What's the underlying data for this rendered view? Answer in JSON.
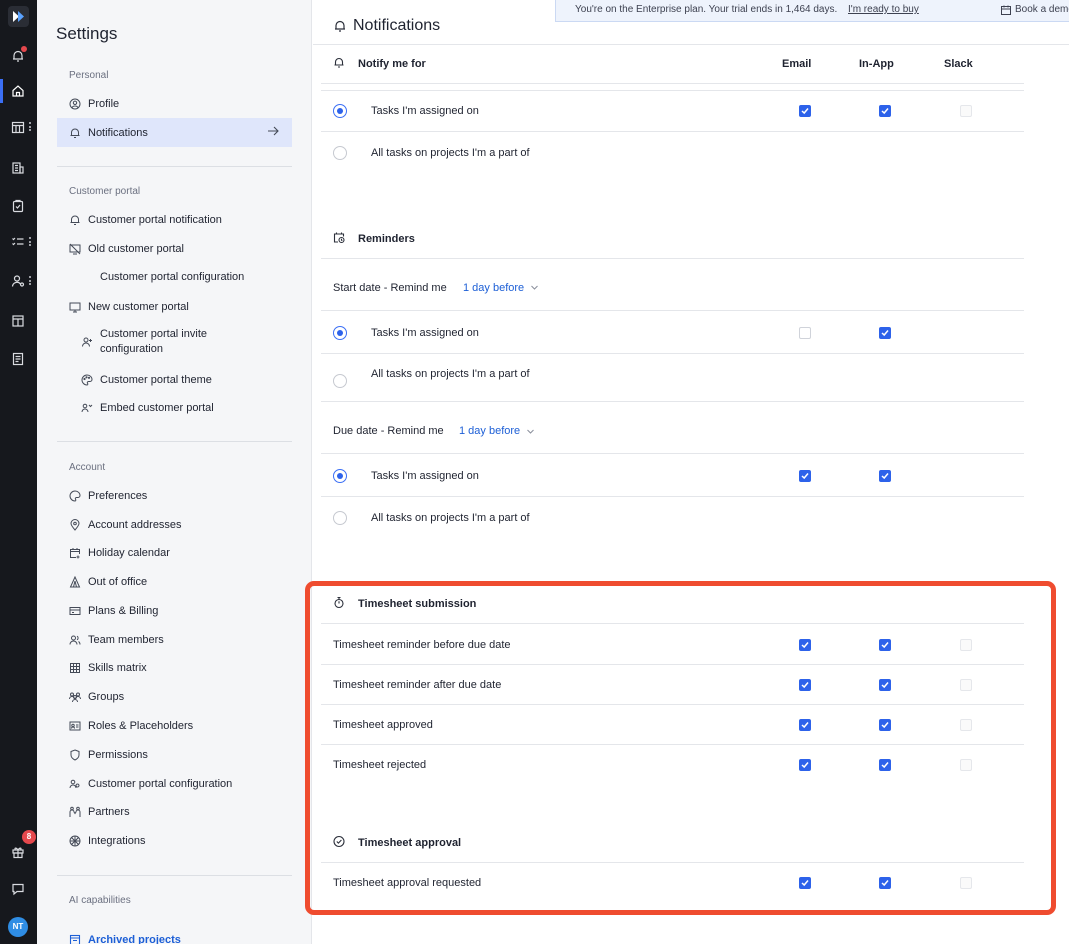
{
  "rail": {
    "avatar": "NT",
    "badge_count": "8"
  },
  "sidebar": {
    "title": "Settings",
    "personal_label": "Personal",
    "personal": [
      {
        "label": "Profile",
        "icon": "user-icon"
      },
      {
        "label": "Notifications",
        "icon": "bell-icon",
        "active": true
      }
    ],
    "customer_portal_label": "Customer portal",
    "customer_portal": [
      {
        "label": "Customer portal notification",
        "icon": "bell-icon"
      },
      {
        "label": "Old customer portal",
        "icon": "monitor-off-icon"
      },
      {
        "label": "Customer portal configuration",
        "icon": "",
        "sub": true
      },
      {
        "label": "New customer portal",
        "icon": "monitor-icon"
      },
      {
        "label": "Customer portal invite configuration",
        "icon": "user-plus-icon",
        "sub": true
      },
      {
        "label": "Customer portal theme",
        "icon": "palette-icon",
        "sub": true
      },
      {
        "label": "Embed customer portal",
        "icon": "users-icon",
        "sub": true
      }
    ],
    "account_label": "Account",
    "account": [
      {
        "label": "Preferences",
        "icon": "palette-icon"
      },
      {
        "label": "Account addresses",
        "icon": "map-pin-icon"
      },
      {
        "label": "Holiday calendar",
        "icon": "calendar-plus-icon"
      },
      {
        "label": "Out of office",
        "icon": "tent-icon"
      },
      {
        "label": "Plans & Billing",
        "icon": "billing-icon"
      },
      {
        "label": "Team members",
        "icon": "users-icon"
      },
      {
        "label": "Skills matrix",
        "icon": "grid-icon"
      },
      {
        "label": "Groups",
        "icon": "group-icon"
      },
      {
        "label": "Roles & Placeholders",
        "icon": "id-card-icon"
      },
      {
        "label": "Permissions",
        "icon": "shield-icon"
      },
      {
        "label": "Customer portal configuration",
        "icon": "users-icon"
      },
      {
        "label": "Partners",
        "icon": "handshake-icon"
      },
      {
        "label": "Integrations",
        "icon": "puzzle-icon"
      }
    ],
    "ai_label": "AI capabilities",
    "archived": "Archived projects"
  },
  "main": {
    "title": "Notifications",
    "banner": {
      "text": "You're on the Enterprise plan. Your trial ends in 1,464 days.",
      "buy": "I'm ready to buy",
      "demo": "Book a demo"
    },
    "columns": [
      "Email",
      "In-App",
      "Slack"
    ],
    "notify_header": "Notify me for",
    "notify_rows": [
      {
        "label": "Tasks I'm assigned on",
        "selected": true,
        "email": true,
        "inapp": true,
        "slack": false
      },
      {
        "label": "All tasks on projects I'm a part of",
        "selected": false
      }
    ],
    "reminders_header": "Reminders",
    "start_label": "Start date - Remind me",
    "start_value": "1 day before",
    "start_rows": [
      {
        "label": "Tasks I'm assigned on",
        "selected": true,
        "email": false,
        "inapp": true
      },
      {
        "label": "All tasks on projects I'm a part of",
        "selected": false
      }
    ],
    "due_label": "Due date - Remind me",
    "due_value": "1 day before",
    "due_rows": [
      {
        "label": "Tasks I'm assigned on",
        "selected": true,
        "email": true,
        "inapp": true
      },
      {
        "label": "All tasks on projects I'm a part of",
        "selected": false
      }
    ],
    "timesheet_header": "Timesheet submission",
    "timesheet_rows": [
      {
        "label": "Timesheet reminder before due date",
        "email": true,
        "inapp": true,
        "slack": false
      },
      {
        "label": "Timesheet reminder after due date",
        "email": true,
        "inapp": true,
        "slack": false
      },
      {
        "label": "Timesheet approved",
        "email": true,
        "inapp": true,
        "slack": false
      },
      {
        "label": "Timesheet rejected",
        "email": true,
        "inapp": true,
        "slack": false
      }
    ],
    "approval_header": "Timesheet approval",
    "approval_rows": [
      {
        "label": "Timesheet approval requested",
        "email": true,
        "inapp": true,
        "slack": false
      }
    ]
  },
  "colors": {
    "accent": "#2d62ea",
    "highlight": "#ef4c2f",
    "rail": "#16181d"
  }
}
